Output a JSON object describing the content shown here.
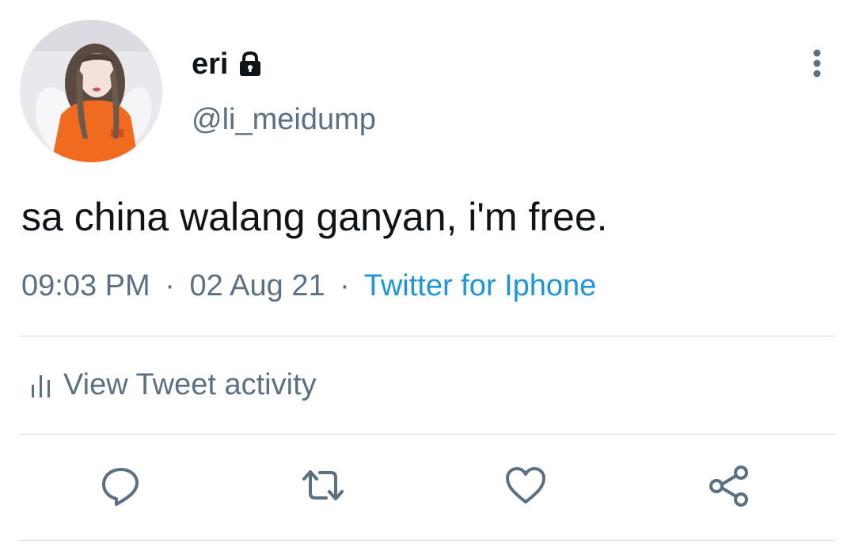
{
  "user": {
    "display_name": "eri",
    "handle": "@li_meidump",
    "protected_icon": "lock-icon",
    "avatar": "profile-photo"
  },
  "tweet": {
    "text": "sa china walang ganyan, i'm free.",
    "time": "09:03 PM",
    "date": "02 Aug 21",
    "separator": "·",
    "source": "Twitter for Iphone"
  },
  "activity": {
    "label": "View Tweet activity",
    "icon": "bar-chart-icon"
  },
  "actions": {
    "reply": "reply-icon",
    "retweet": "retweet-icon",
    "like": "heart-icon",
    "share": "share-icon"
  },
  "colors": {
    "primary_text": "#0f1419",
    "secondary_text": "#5b7083",
    "link": "#1b95e0",
    "divider": "#cfd9de"
  }
}
